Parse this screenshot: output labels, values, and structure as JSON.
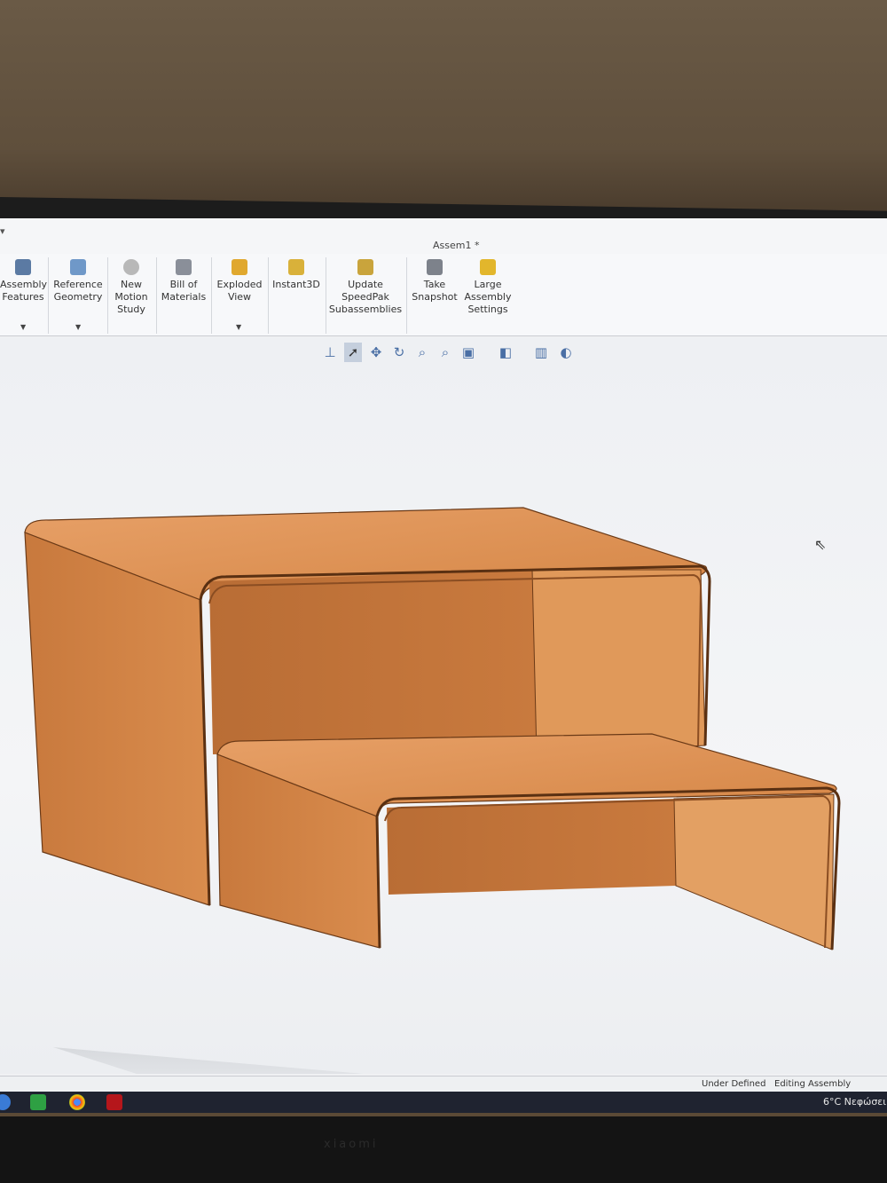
{
  "window": {
    "title": "Assem1 *",
    "quick_access": "▾"
  },
  "ribbon": {
    "items": [
      {
        "label": "Assembly\nFeatures",
        "icon": "assembly-features-icon"
      },
      {
        "label": "Reference\nGeometry",
        "icon": "reference-geometry-icon"
      },
      {
        "label": "New\nMotion\nStudy",
        "icon": "motion-study-icon"
      },
      {
        "label": "Bill of\nMaterials",
        "icon": "bom-icon"
      },
      {
        "label": "Exploded\nView",
        "icon": "exploded-view-icon"
      },
      {
        "label": "Instant3D",
        "icon": "instant3d-icon"
      },
      {
        "label": "Update\nSpeedPak\nSubassemblies",
        "icon": "speedpak-icon"
      },
      {
        "label": "Take\nSnapshot",
        "icon": "camera-icon"
      },
      {
        "label": "Large\nAssembly\nSettings",
        "icon": "large-assembly-icon"
      }
    ]
  },
  "status": {
    "left": "Under Defined",
    "right": "Editing Assembly"
  },
  "taskbar": {
    "weather": "6°C  Νεφώσει"
  },
  "monitor": {
    "brand": "xiaomi"
  },
  "colors": {
    "wood": "#d98a4a",
    "wood_dark": "#b9652c",
    "accent": "#4a6fa5"
  }
}
